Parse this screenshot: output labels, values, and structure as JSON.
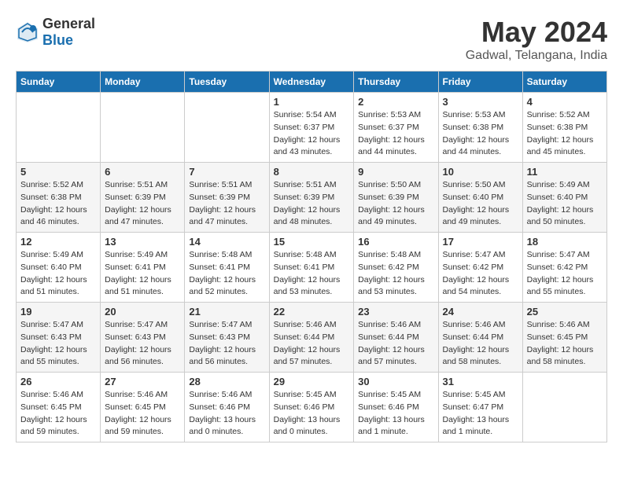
{
  "header": {
    "logo_general": "General",
    "logo_blue": "Blue",
    "month_year": "May 2024",
    "location": "Gadwal, Telangana, India"
  },
  "weekdays": [
    "Sunday",
    "Monday",
    "Tuesday",
    "Wednesday",
    "Thursday",
    "Friday",
    "Saturday"
  ],
  "weeks": [
    [
      {
        "day": "",
        "info": ""
      },
      {
        "day": "",
        "info": ""
      },
      {
        "day": "",
        "info": ""
      },
      {
        "day": "1",
        "info": "Sunrise: 5:54 AM\nSunset: 6:37 PM\nDaylight: 12 hours\nand 43 minutes."
      },
      {
        "day": "2",
        "info": "Sunrise: 5:53 AM\nSunset: 6:37 PM\nDaylight: 12 hours\nand 44 minutes."
      },
      {
        "day": "3",
        "info": "Sunrise: 5:53 AM\nSunset: 6:38 PM\nDaylight: 12 hours\nand 44 minutes."
      },
      {
        "day": "4",
        "info": "Sunrise: 5:52 AM\nSunset: 6:38 PM\nDaylight: 12 hours\nand 45 minutes."
      }
    ],
    [
      {
        "day": "5",
        "info": "Sunrise: 5:52 AM\nSunset: 6:38 PM\nDaylight: 12 hours\nand 46 minutes."
      },
      {
        "day": "6",
        "info": "Sunrise: 5:51 AM\nSunset: 6:39 PM\nDaylight: 12 hours\nand 47 minutes."
      },
      {
        "day": "7",
        "info": "Sunrise: 5:51 AM\nSunset: 6:39 PM\nDaylight: 12 hours\nand 47 minutes."
      },
      {
        "day": "8",
        "info": "Sunrise: 5:51 AM\nSunset: 6:39 PM\nDaylight: 12 hours\nand 48 minutes."
      },
      {
        "day": "9",
        "info": "Sunrise: 5:50 AM\nSunset: 6:39 PM\nDaylight: 12 hours\nand 49 minutes."
      },
      {
        "day": "10",
        "info": "Sunrise: 5:50 AM\nSunset: 6:40 PM\nDaylight: 12 hours\nand 49 minutes."
      },
      {
        "day": "11",
        "info": "Sunrise: 5:49 AM\nSunset: 6:40 PM\nDaylight: 12 hours\nand 50 minutes."
      }
    ],
    [
      {
        "day": "12",
        "info": "Sunrise: 5:49 AM\nSunset: 6:40 PM\nDaylight: 12 hours\nand 51 minutes."
      },
      {
        "day": "13",
        "info": "Sunrise: 5:49 AM\nSunset: 6:41 PM\nDaylight: 12 hours\nand 51 minutes."
      },
      {
        "day": "14",
        "info": "Sunrise: 5:48 AM\nSunset: 6:41 PM\nDaylight: 12 hours\nand 52 minutes."
      },
      {
        "day": "15",
        "info": "Sunrise: 5:48 AM\nSunset: 6:41 PM\nDaylight: 12 hours\nand 53 minutes."
      },
      {
        "day": "16",
        "info": "Sunrise: 5:48 AM\nSunset: 6:42 PM\nDaylight: 12 hours\nand 53 minutes."
      },
      {
        "day": "17",
        "info": "Sunrise: 5:47 AM\nSunset: 6:42 PM\nDaylight: 12 hours\nand 54 minutes."
      },
      {
        "day": "18",
        "info": "Sunrise: 5:47 AM\nSunset: 6:42 PM\nDaylight: 12 hours\nand 55 minutes."
      }
    ],
    [
      {
        "day": "19",
        "info": "Sunrise: 5:47 AM\nSunset: 6:43 PM\nDaylight: 12 hours\nand 55 minutes."
      },
      {
        "day": "20",
        "info": "Sunrise: 5:47 AM\nSunset: 6:43 PM\nDaylight: 12 hours\nand 56 minutes."
      },
      {
        "day": "21",
        "info": "Sunrise: 5:47 AM\nSunset: 6:43 PM\nDaylight: 12 hours\nand 56 minutes."
      },
      {
        "day": "22",
        "info": "Sunrise: 5:46 AM\nSunset: 6:44 PM\nDaylight: 12 hours\nand 57 minutes."
      },
      {
        "day": "23",
        "info": "Sunrise: 5:46 AM\nSunset: 6:44 PM\nDaylight: 12 hours\nand 57 minutes."
      },
      {
        "day": "24",
        "info": "Sunrise: 5:46 AM\nSunset: 6:44 PM\nDaylight: 12 hours\nand 58 minutes."
      },
      {
        "day": "25",
        "info": "Sunrise: 5:46 AM\nSunset: 6:45 PM\nDaylight: 12 hours\nand 58 minutes."
      }
    ],
    [
      {
        "day": "26",
        "info": "Sunrise: 5:46 AM\nSunset: 6:45 PM\nDaylight: 12 hours\nand 59 minutes."
      },
      {
        "day": "27",
        "info": "Sunrise: 5:46 AM\nSunset: 6:45 PM\nDaylight: 12 hours\nand 59 minutes."
      },
      {
        "day": "28",
        "info": "Sunrise: 5:46 AM\nSunset: 6:46 PM\nDaylight: 13 hours\nand 0 minutes."
      },
      {
        "day": "29",
        "info": "Sunrise: 5:45 AM\nSunset: 6:46 PM\nDaylight: 13 hours\nand 0 minutes."
      },
      {
        "day": "30",
        "info": "Sunrise: 5:45 AM\nSunset: 6:46 PM\nDaylight: 13 hours\nand 1 minute."
      },
      {
        "day": "31",
        "info": "Sunrise: 5:45 AM\nSunset: 6:47 PM\nDaylight: 13 hours\nand 1 minute."
      },
      {
        "day": "",
        "info": ""
      }
    ]
  ]
}
